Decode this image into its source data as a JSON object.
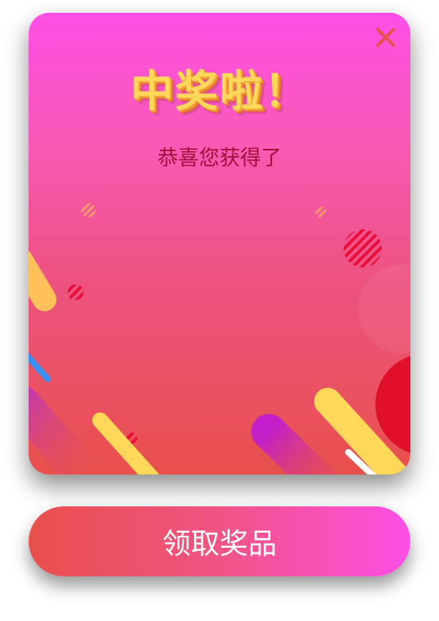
{
  "dialog": {
    "title": "中奖啦！",
    "subtitle": "恭喜您获得了"
  },
  "claim_button": {
    "label": "领取奖品"
  },
  "icons": {
    "close": "close-icon"
  },
  "colors": {
    "gradient_top": "#ff4fe6",
    "gradient_bottom": "#e8504c",
    "title": "#ffd85a",
    "subtitle": "#a0103a",
    "close": "#e8504c"
  }
}
